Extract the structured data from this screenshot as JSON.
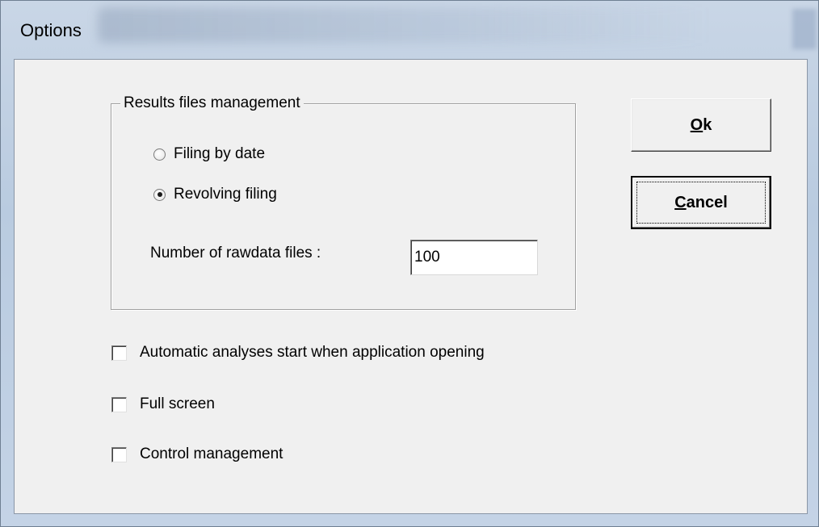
{
  "window": {
    "title": "Options"
  },
  "results_group": {
    "legend": "Results files management",
    "radio_options": [
      {
        "label": "Filing by date",
        "selected": false
      },
      {
        "label": "Revolving filing",
        "selected": true
      }
    ],
    "rawdata_label": "Number of rawdata files :",
    "rawdata_value": "100"
  },
  "checkboxes": [
    {
      "label": "Automatic analyses start when application opening",
      "checked": false
    },
    {
      "label": "Full screen",
      "checked": false
    },
    {
      "label": "Control management",
      "checked": false
    }
  ],
  "buttons": {
    "ok": {
      "accel": "O",
      "rest": "k"
    },
    "cancel": {
      "accel": "C",
      "rest": "ancel"
    }
  }
}
